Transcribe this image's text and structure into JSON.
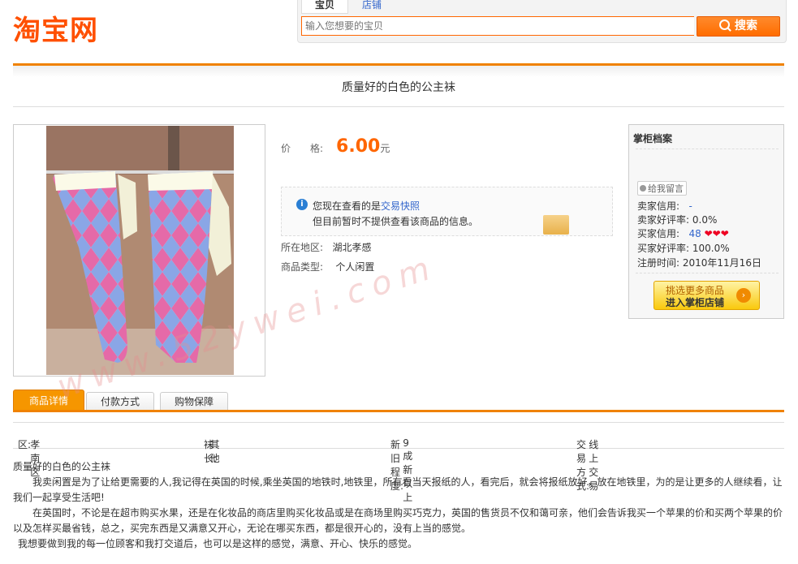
{
  "header": {
    "logo_text": "淘宝网",
    "search": {
      "tab_items": "宝贝",
      "tab_shops": "店铺",
      "placeholder": "输入您想要的宝贝",
      "button_label": "搜索"
    }
  },
  "item": {
    "title": "质量好的白色的公主袜",
    "price_label": "价　　格:",
    "price_value": "6.00",
    "price_unit": "元",
    "notice_line1_prefix": "您现在查看的是",
    "notice_link": "交易快照",
    "notice_line2": "但目前暂时不提供查看该商品的信息。",
    "location_label": "所在地区:",
    "location_value": "湖北孝感",
    "type_label": "商品类型:",
    "type_value": "个人闲置"
  },
  "seller": {
    "title": "掌柜档案",
    "message_button": "给我留言",
    "rows": [
      {
        "label": "卖家信用:",
        "value": "-"
      },
      {
        "label": "卖家好评率:",
        "value": "0.0%"
      },
      {
        "label": "买家信用:",
        "value": "48"
      },
      {
        "label": "买家好评率:",
        "value": "100.0%"
      },
      {
        "label": "注册时间:",
        "value": "2010年11月16日"
      }
    ],
    "buyer_hearts": "❤❤❤",
    "shop_button_line1": "挑选更多商品",
    "shop_button_line2": "进入掌柜店铺",
    "shop_button_arrow": "›"
  },
  "tabs": [
    "商品详情",
    "付款方式",
    "购物保障"
  ],
  "attributes": [
    {
      "label": "区:",
      "value": "孝南区"
    },
    {
      "label": "袜长:",
      "value": "其他"
    },
    {
      "label": "新旧程度:",
      "value": "9成新以上"
    },
    {
      "label": "交易方式:",
      "value": "线上交易"
    }
  ],
  "description": {
    "heading": "质量好的白色的公主袜",
    "p1": "我卖闲置是为了让给更需要的人,我记得在英国的时候,乘坐英国的地铁时,地铁里，所有看当天报纸的人，看完后，就会将报纸放好，放在地铁里，为的是让更多的人继续看，让我们一起享受生活吧!",
    "p2": "在英国时，不论是在超市购买水果，还是在化妆品的商店里购买化妆品或是在商场里购买巧克力，英国的售货员不仅和蔼可亲，他们会告诉我买一个苹果的价和买两个苹果的价以及怎样买最省钱，总之，买完东西是又满意又开心，无论在哪买东西，都是很开心的，没有上当的感觉。",
    "p3": "我想要做到我的每一位顾客和我打交道后，也可以是这样的感觉，满意、开心、快乐的感觉。"
  },
  "watermark": "www.52ywei.com"
}
